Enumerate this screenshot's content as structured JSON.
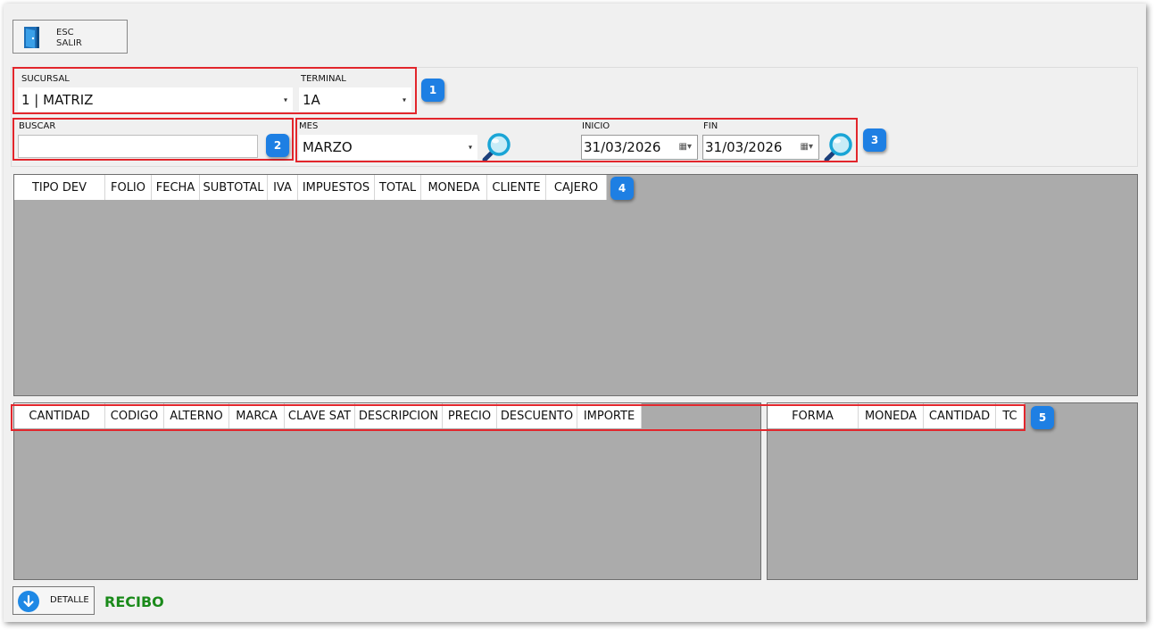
{
  "toolbar": {
    "exit_key": "ESC",
    "exit_label": "SALIR"
  },
  "filters": {
    "sucursal_label": "SUCURSAL",
    "sucursal_value": "1 | MATRIZ",
    "terminal_label": "TERMINAL",
    "terminal_value": "1A",
    "buscar_label": "BUSCAR",
    "buscar_value": "",
    "mes_label": "MES",
    "mes_value": "MARZO",
    "inicio_label": "INICIO",
    "inicio_value": "31/03/2026",
    "fin_label": "FIN",
    "fin_value": "31/03/2026"
  },
  "badges": [
    "1",
    "2",
    "3",
    "4",
    "5"
  ],
  "returns_grid": {
    "columns": [
      "TIPO DEV",
      "FOLIO",
      "FECHA",
      "SUBTOTAL",
      "IVA",
      "IMPUESTOS",
      "TOTAL",
      "MONEDA",
      "CLIENTE",
      "CAJERO"
    ]
  },
  "detail_grid": {
    "columns": [
      "CANTIDAD",
      "CODIGO",
      "ALTERNO",
      "MARCA",
      "CLAVE SAT",
      "DESCRIPCION",
      "PRECIO",
      "DESCUENTO",
      "IMPORTE"
    ]
  },
  "payment_grid": {
    "columns": [
      "FORMA",
      "MONEDA",
      "CANTIDAD",
      "TC"
    ]
  },
  "footer": {
    "detail_label": "DETALLE",
    "recibo_label": "RECIBO"
  },
  "colors": {
    "highlight": "#e2262c",
    "badge": "#1e7fe3",
    "recibo": "#1a8a1a",
    "grid_bg": "#ababab"
  }
}
